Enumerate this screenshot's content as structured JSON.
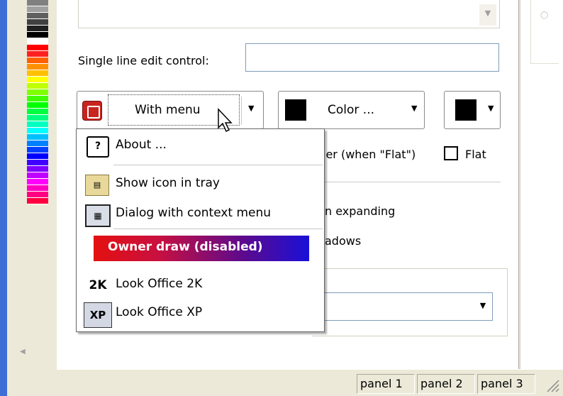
{
  "form": {
    "single_line_label": "Single line edit control:",
    "single_line_value": ""
  },
  "toolbar": {
    "menu_button_label": "With menu",
    "color_button_label": "Color ...",
    "color_swatch": "#000000",
    "color2_swatch": "#000000"
  },
  "behind": {
    "border_label": "ler (when \"Flat\")",
    "flat_label": "Flat",
    "flat_checked": false,
    "expanding_label": "n expanding",
    "shadows_label": "adows"
  },
  "menu": {
    "items": [
      {
        "label": "About ...",
        "icon": "help-icon",
        "icon_text": "?"
      },
      {
        "label": "Show icon in tray",
        "icon": "tray-icon",
        "icon_text": ""
      },
      {
        "label": "Dialog with context menu",
        "icon": "dialog-icon",
        "icon_text": ""
      },
      {
        "label": "Owner draw (disabled)",
        "icon": "",
        "icon_text": ""
      },
      {
        "label": "Look Office 2K",
        "icon": "office-2k-icon",
        "icon_text": "2K"
      },
      {
        "label": "Look Office XP",
        "icon": "office-xp-icon",
        "icon_text": "XP"
      }
    ]
  },
  "statusbar": {
    "panels": [
      "panel 1",
      "panel 2",
      "panel 3"
    ]
  },
  "palette": [
    "#808080",
    "#a0a0a0",
    "#606060",
    "#404040",
    "#202020",
    "#000000",
    "#ffffff",
    "#ff0000",
    "#ff2020",
    "#ff6000",
    "#ff9000",
    "#ffc000",
    "#ffff00",
    "#c0ff00",
    "#80ff00",
    "#40ff00",
    "#00ff00",
    "#00ff40",
    "#00ff80",
    "#00ffc0",
    "#00ffff",
    "#00c0ff",
    "#0080ff",
    "#0040ff",
    "#0000ff",
    "#4000ff",
    "#8000ff",
    "#c000ff",
    "#ff00ff",
    "#ff00c0",
    "#ff0080",
    "#ff0040"
  ]
}
